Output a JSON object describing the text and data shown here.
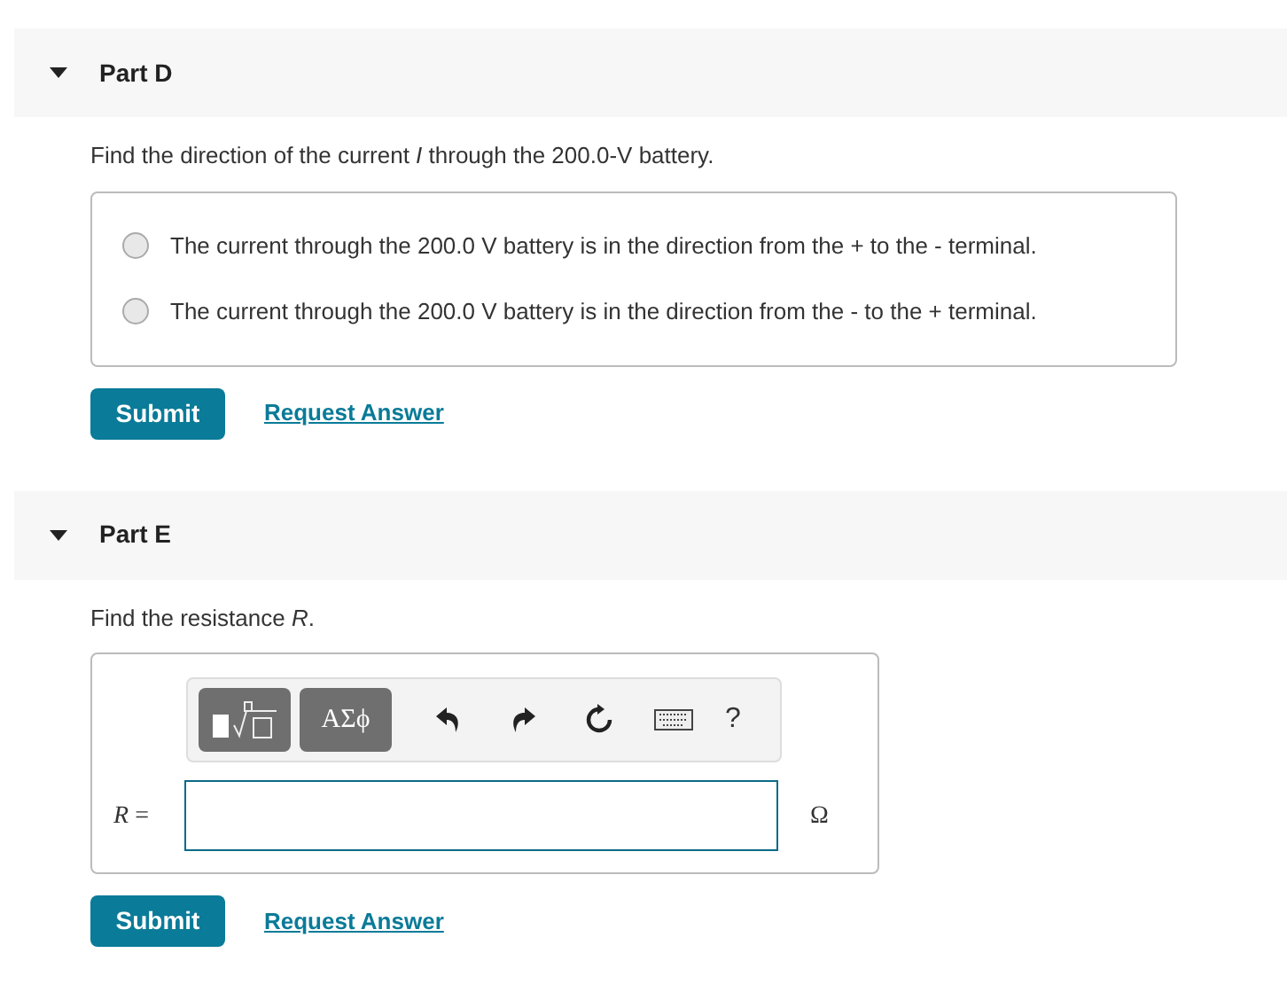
{
  "parts": [
    {
      "kind": "choice",
      "title": "Part D",
      "expanded": true,
      "question": "Find the direction of the current *I* through the 200.0-V battery.",
      "options": [
        {
          "label": "The current through the 200.0 V battery is in the direction from the + to the - terminal.",
          "selected": false
        },
        {
          "label": "The current through the 200.0 V battery is in the direction from the - to the + terminal.",
          "selected": false
        }
      ],
      "submit": "Submit",
      "request": "Request Answer"
    },
    {
      "kind": "numeric",
      "title": "Part E",
      "expanded": true,
      "question": "Find the resistance *R*.",
      "toolbar": {
        "symbols": "ΑΣϕ",
        "help": "?"
      },
      "variable": "*R* =",
      "unit": "Ω",
      "submit": "Submit",
      "request": "Request Answer"
    }
  ]
}
